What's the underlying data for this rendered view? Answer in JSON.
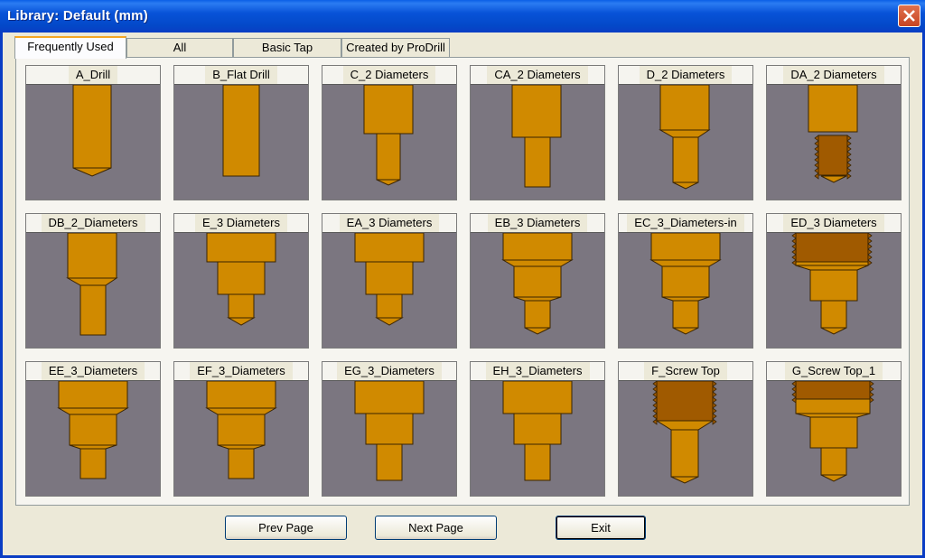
{
  "window": {
    "title": "Library: Default (mm)"
  },
  "tabs": [
    {
      "label": "Frequently Used",
      "active": true
    },
    {
      "label": "All",
      "active": false
    },
    {
      "label": "Basic Tap",
      "active": false
    },
    {
      "label": "Created by ProDrill",
      "active": false
    }
  ],
  "tools": [
    {
      "label": "A_Drill",
      "shape": "drill",
      "threaded": false
    },
    {
      "label": "B_Flat Drill",
      "shape": "flat",
      "threaded": false
    },
    {
      "label": "C_2 Diameters",
      "shape": "two-step",
      "threaded": false
    },
    {
      "label": "CA_2 Diameters",
      "shape": "two-flat",
      "threaded": false
    },
    {
      "label": "D_2 Diameters",
      "shape": "two-chamfer",
      "threaded": false
    },
    {
      "label": "DA_2 Diameters",
      "shape": "two-thread",
      "threaded": true
    },
    {
      "label": "DB_2_Diameters",
      "shape": "two-chamfer-flat",
      "threaded": false
    },
    {
      "label": "E_3 Diameters",
      "shape": "three-step",
      "threaded": false
    },
    {
      "label": "EA_3 Diameters",
      "shape": "three-step",
      "threaded": false
    },
    {
      "label": "EB_3 Diameters",
      "shape": "three-chamfer",
      "threaded": false
    },
    {
      "label": "EC_3_Diameters-in",
      "shape": "three-chamfer",
      "threaded": false
    },
    {
      "label": "ED_3 Diameters",
      "shape": "three-thread-top",
      "threaded": true
    },
    {
      "label": "EE_3_Diameters",
      "shape": "three-chamfer-flat",
      "threaded": false
    },
    {
      "label": "EF_3_Diameters",
      "shape": "three-chamfer-flat",
      "threaded": false
    },
    {
      "label": "EG_3_Diameters",
      "shape": "three-step-flat",
      "threaded": false
    },
    {
      "label": "EH_3_Diameters",
      "shape": "three-step-flat",
      "threaded": false
    },
    {
      "label": "F_Screw Top",
      "shape": "screw-top",
      "threaded": true
    },
    {
      "label": "G_Screw Top_1",
      "shape": "screw-top-3",
      "threaded": true
    }
  ],
  "buttons": {
    "prev": "Prev Page",
    "next": "Next Page",
    "exit": "Exit"
  },
  "colors": {
    "tool": "#d08a00",
    "thread": "#a05a00",
    "background": "#7b7680"
  }
}
